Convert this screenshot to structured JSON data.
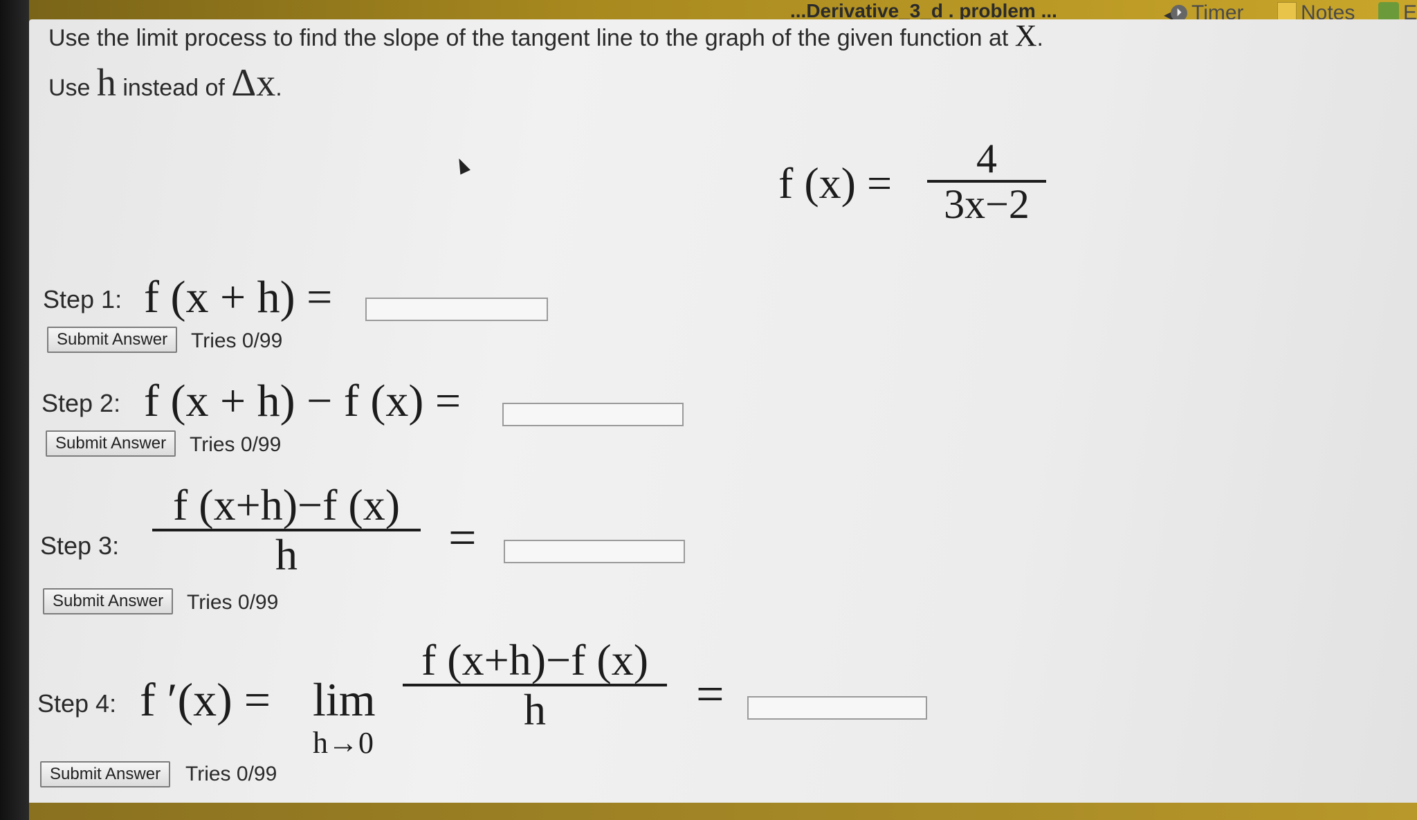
{
  "topbar": {
    "doc_title": "...Derivative_3_d . problem ...",
    "timer_label": "Timer",
    "notes_label": "Notes",
    "extra_label": "E"
  },
  "instructions": {
    "line1": "Use the limit process to find the slope of the tangent line to the graph of the given function at",
    "line1_var": "X",
    "line1_end": ".",
    "line2_use": "Use",
    "line2_h": "h",
    "line2_instead": "instead of",
    "line2_dx": "Δx",
    "line2_end": "."
  },
  "function": {
    "lhs": "f (x) =",
    "numerator": "4",
    "denominator": "3x−2"
  },
  "steps": [
    {
      "label": "Step 1:",
      "expr": "f (x + h) =",
      "submit": "Submit Answer",
      "tries": "Tries 0/99",
      "answer": ""
    },
    {
      "label": "Step 2:",
      "expr": "f (x + h) − f (x) =",
      "submit": "Submit Answer",
      "tries": "Tries 0/99",
      "answer": ""
    },
    {
      "label": "Step 3:",
      "numerator": "f (x+h)−f (x)",
      "denominator": "h",
      "equals": "=",
      "submit": "Submit Answer",
      "tries": "Tries 0/99",
      "answer": ""
    },
    {
      "label": "Step 4:",
      "lhs": "f ′(x) =",
      "lim": "lim",
      "lim_sub": "h→0",
      "numerator": "f (x+h)−f (x)",
      "denominator": "h",
      "equals": "=",
      "submit": "Submit Answer",
      "tries": "Tries 0/99",
      "answer": ""
    }
  ]
}
